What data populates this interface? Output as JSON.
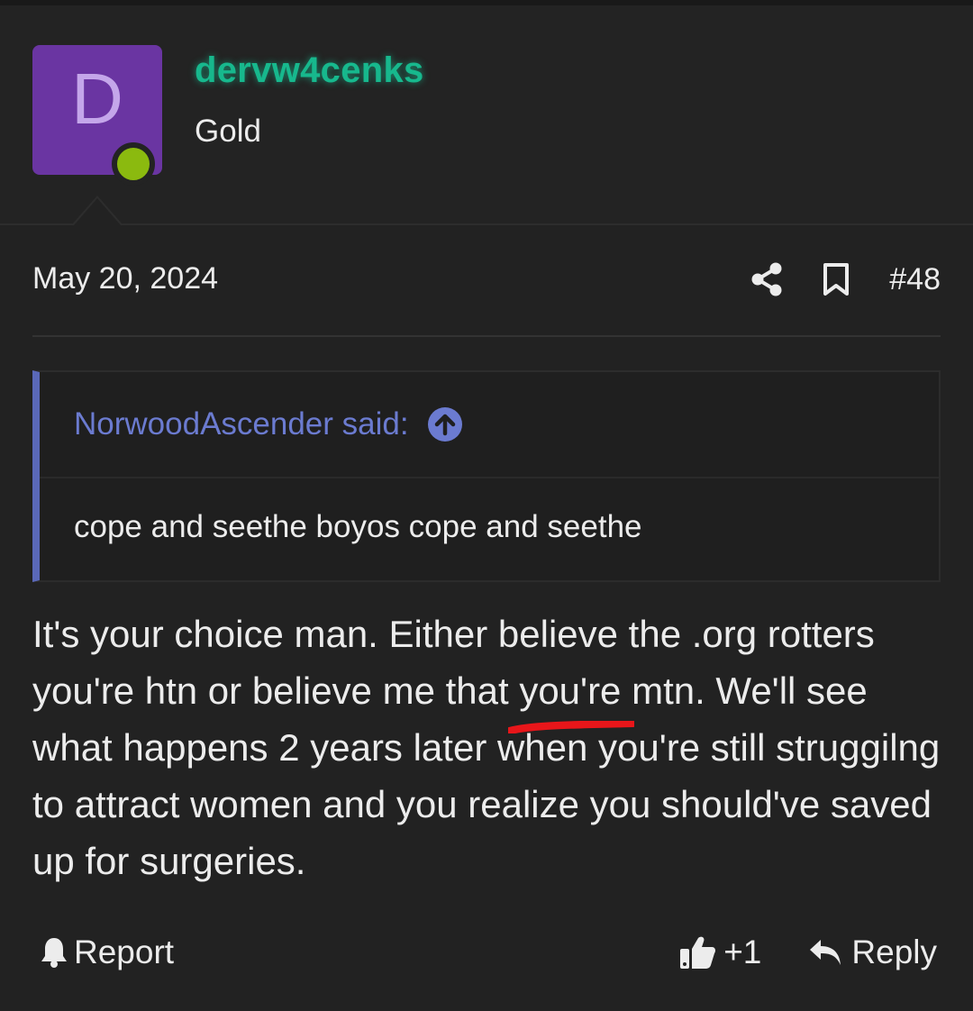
{
  "user": {
    "avatar_letter": "D",
    "username": "dervw4cenks",
    "title": "Gold",
    "username_color": "#17b88d",
    "avatar_color": "#6a35a2",
    "online_color": "#8bba0f"
  },
  "post": {
    "date": "May 20, 2024",
    "number": "#48",
    "icons": [
      "share-icon",
      "bookmark-icon"
    ]
  },
  "quote": {
    "author_line": "NorwoodAscender said:",
    "icon": "arrow-up-circle-icon",
    "text": "cope and seethe boyos cope and seethe",
    "accent_color": "#5a68b8"
  },
  "message": {
    "part1": "It's your choice man. Either believe the .org rotters you're htn or believe me that ",
    "highlight": "you're mtn",
    "part2": ". We'll see what happens 2 years later when you're still struggilng to attract women and you realize you should've saved up for surgeries."
  },
  "footer": {
    "report_label": "Report",
    "like_count": "+1",
    "reply_label": "Reply"
  }
}
